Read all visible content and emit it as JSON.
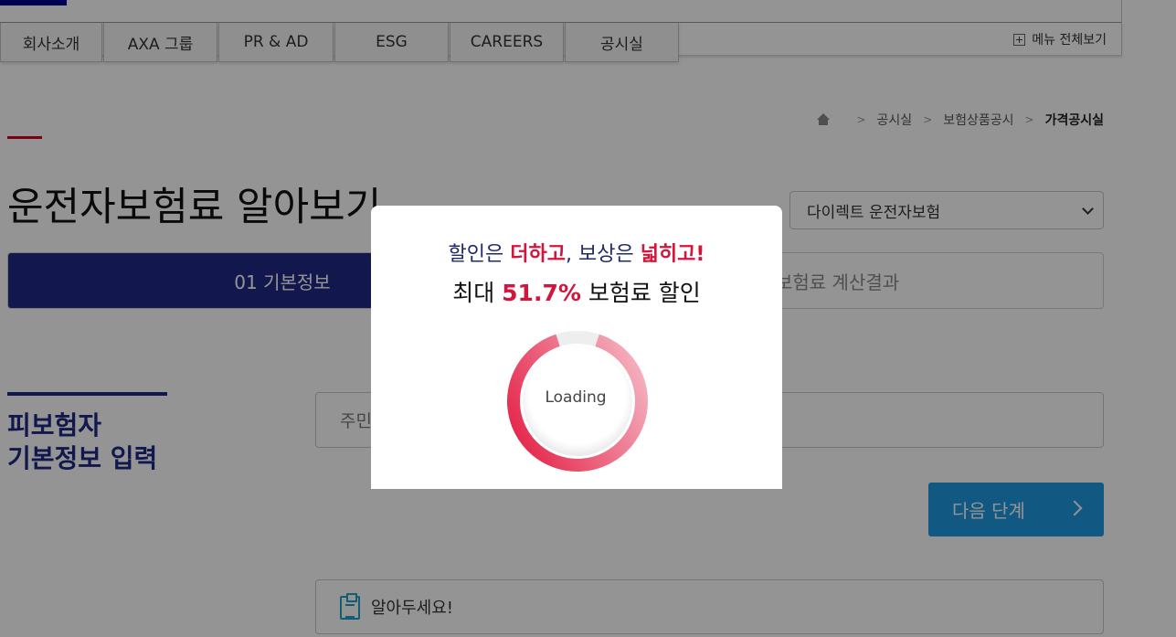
{
  "header": {
    "nav_tabs": [
      "회사소개",
      "AXA 그룹",
      "PR & AD",
      "ESG",
      "CAREERS",
      "공시실"
    ],
    "menu_all_label": "메뉴 전체보기"
  },
  "breadcrumb": {
    "items": [
      "공시실",
      "보험상품공시",
      "가격공시실"
    ],
    "separator": ">"
  },
  "page": {
    "title": "운전자보험료 알아보기",
    "product_select": {
      "selected": "다이렉트 운전자보험"
    }
  },
  "steps": {
    "active": "01 기본정보",
    "inactive_visible": "보험료 계산결과"
  },
  "section": {
    "title_line1": "피보험자",
    "title_line2": "기본정보 입력"
  },
  "form": {
    "input_placeholder": "주민"
  },
  "actions": {
    "next_label": "다음 단계"
  },
  "notice": {
    "label": "알아두세요!"
  },
  "modal": {
    "line1": {
      "p1": "할인은 ",
      "h1": "더하고",
      "p2": ", 보상은 ",
      "h2": "넓히고!"
    },
    "line2": {
      "p1": "최대 ",
      "h1": "51.7%",
      "p2": " 보험료 할인"
    },
    "loading_label": "Loading",
    "progress_percent": 90
  },
  "colors": {
    "brand_blue": "#1f2a86",
    "accent_red": "#d4153b",
    "button_blue": "#1e9ae0"
  },
  "icons": [
    "plus-icon",
    "home-icon",
    "chevron-down-icon",
    "chevron-right-icon",
    "clipboard-icon"
  ]
}
